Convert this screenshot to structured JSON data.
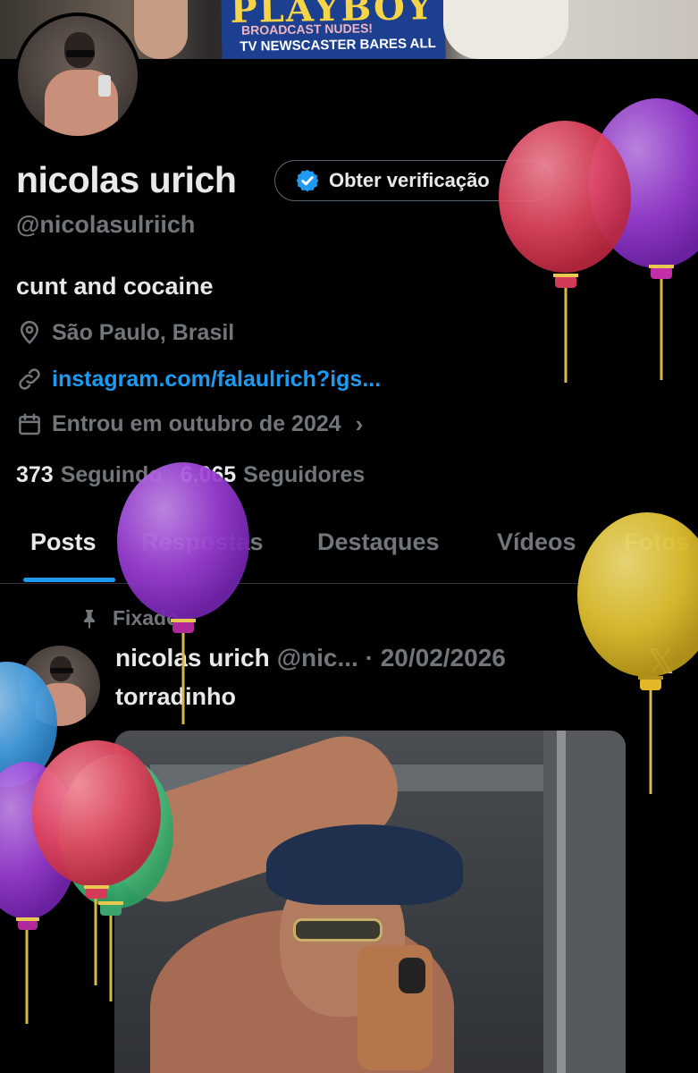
{
  "banner": {
    "magazine_title": "PLAYBOY",
    "magazine_headline": "BROADCAST NUDES!",
    "magazine_subline": "TV NEWSCASTER BARES ALL"
  },
  "profile": {
    "display_name": "nicolas urich",
    "verify_button_label": "Obter verificação",
    "handle": "@nicolasulriich",
    "bio": "cunt and cocaine",
    "location": "São Paulo, Brasil",
    "link": "instagram.com/falaulrich?igs...",
    "joined": "Entrou em outubro de 2024",
    "following_count": "373",
    "following_label": "Seguindo",
    "followers_count": "6.065",
    "followers_label": "Seguidores"
  },
  "tabs": [
    {
      "label": "Posts",
      "active": true
    },
    {
      "label": "Respostas",
      "active": false
    },
    {
      "label": "Destaques",
      "active": false
    },
    {
      "label": "Vídeos",
      "active": false
    },
    {
      "label": "Fotos",
      "active": false
    }
  ],
  "post": {
    "pinned_label": "Fixado",
    "author_name": "nicolas urich",
    "author_meta": "@nic... · 20/02/2026",
    "text": "torradinho",
    "platform_icon": "x-logo"
  },
  "colors": {
    "accent": "#1d9bf0",
    "muted_text": "#71767b",
    "primary_text": "#e7e9ea",
    "background": "#000000",
    "balloon_red": "#e0455f",
    "balloon_purple": "#9b3fd6",
    "balloon_yellow": "#e2c230",
    "balloon_blue": "#4aa3e6",
    "balloon_green": "#4fc98a"
  }
}
